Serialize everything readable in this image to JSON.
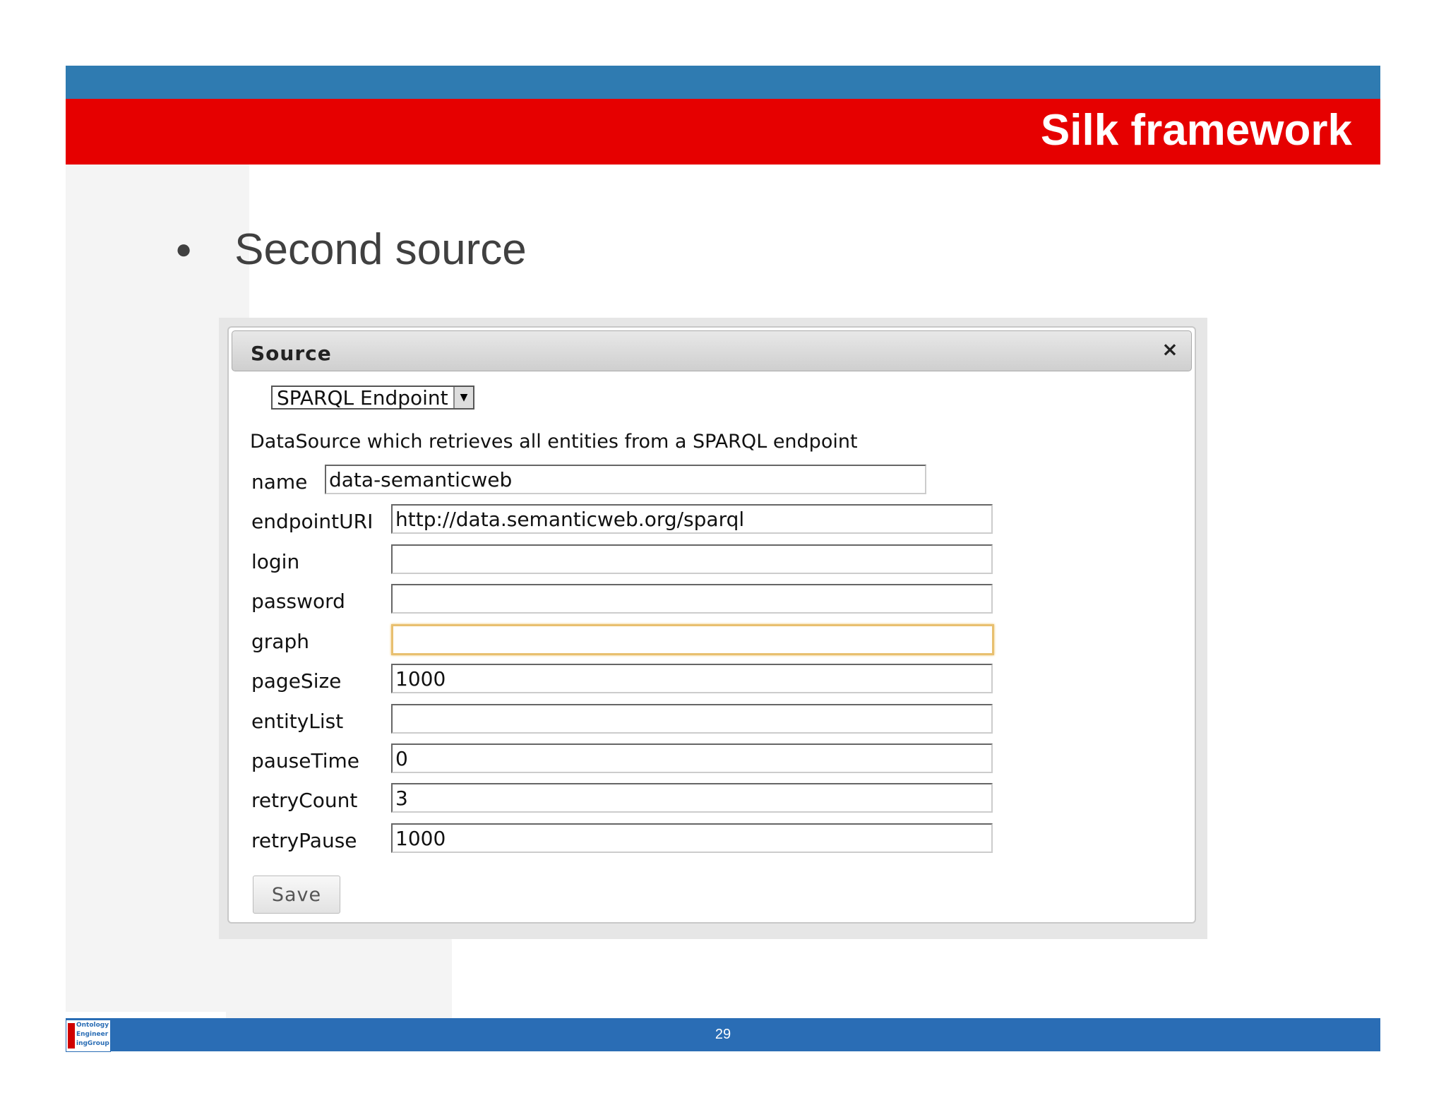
{
  "slide": {
    "title": "Silk framework",
    "bullet": "Second source",
    "page_number": "29",
    "logo_lines": [
      "Ontology",
      "Engineer",
      "ingGroup"
    ]
  },
  "dialog": {
    "title": "Source",
    "close_icon": "×",
    "datasource_type": "SPARQL Endpoint",
    "description": "DataSource which retrieves all entities from a SPARQL endpoint",
    "fields": [
      {
        "label": "name",
        "value": ""
      },
      {
        "label": "endpointURI",
        "value": "http://data.semanticweb.org/sparql"
      },
      {
        "label": "login",
        "value": ""
      },
      {
        "label": "password",
        "value": ""
      },
      {
        "label": "graph",
        "value": ""
      },
      {
        "label": "pageSize",
        "value": "1000"
      },
      {
        "label": "entityList",
        "value": ""
      },
      {
        "label": "pauseTime",
        "value": "0"
      },
      {
        "label": "retryCount",
        "value": "3"
      },
      {
        "label": "retryPause",
        "value": "1000"
      }
    ],
    "name_value": "data-semanticweb",
    "save_label": "Save"
  },
  "colors": {
    "header_red": "#e60000",
    "header_blue": "#2f7bb1",
    "footer_blue": "#2a6db5"
  }
}
